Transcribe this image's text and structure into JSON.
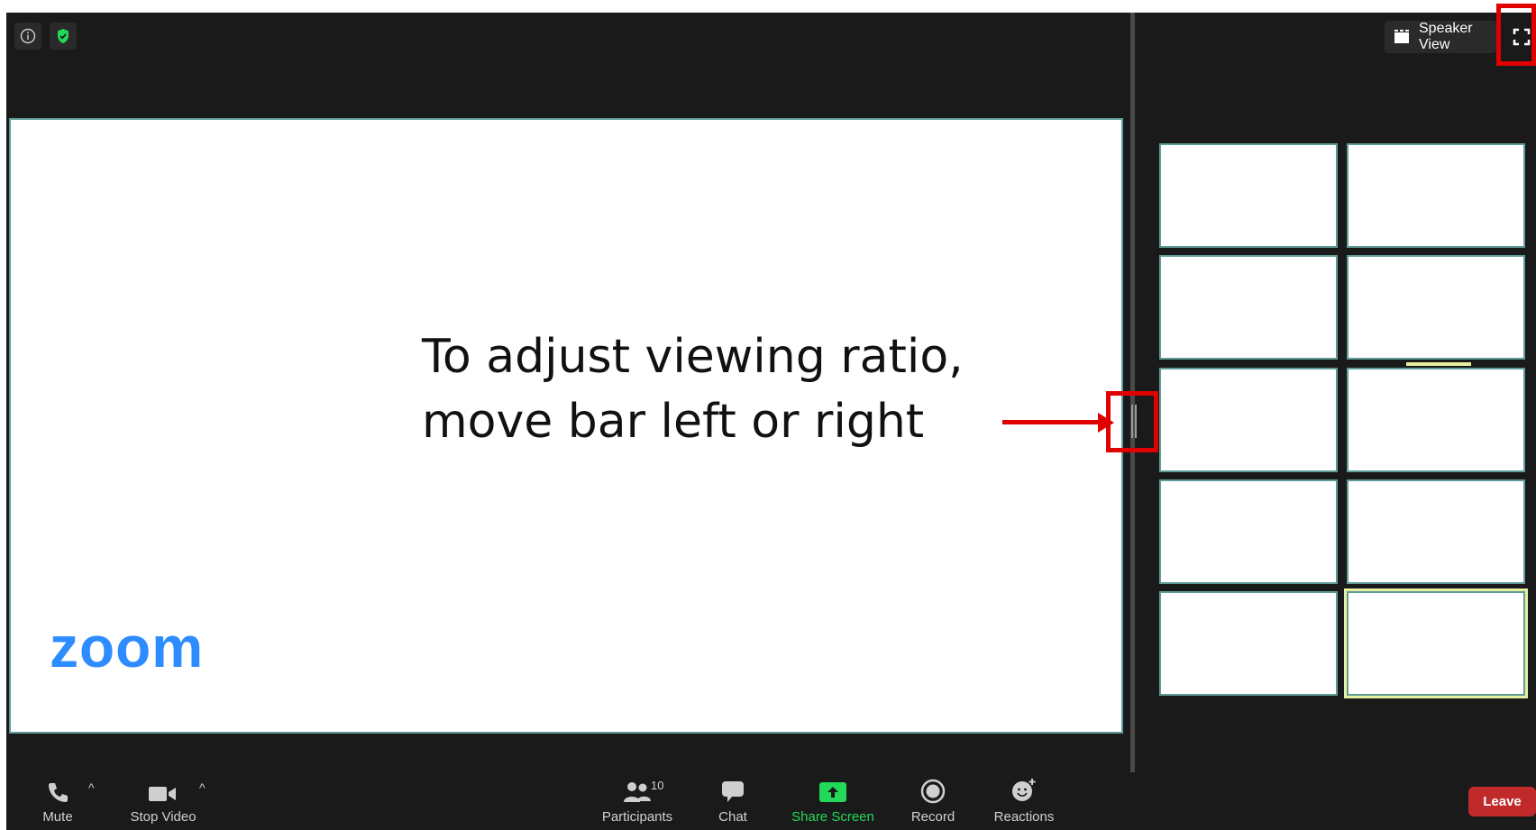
{
  "main": {
    "instruction_line1": "To adjust viewing ratio,",
    "instruction_line2": "move bar left or right",
    "logo_text": "zoom"
  },
  "header": {
    "info_icon": "info-icon",
    "security_icon": "shield-check-icon",
    "speaker_view_label": "Speaker View",
    "fullscreen_icon": "fullscreen-icon"
  },
  "gallery": {
    "tile_count": 10,
    "active_tile_index": 9
  },
  "toolbar": {
    "mute_label": "Mute",
    "stop_video_label": "Stop Video",
    "participants_label": "Participants",
    "participants_count": "10",
    "chat_label": "Chat",
    "share_screen_label": "Share Screen",
    "record_label": "Record",
    "reactions_label": "Reactions",
    "leave_label": "Leave"
  },
  "colors": {
    "background": "#1a1a1a",
    "accent_blue": "#2d8cff",
    "share_green": "#23d959",
    "leave_red": "#c02a2a",
    "annotation_red": "#e00000",
    "tile_border": "#5f9c98"
  }
}
